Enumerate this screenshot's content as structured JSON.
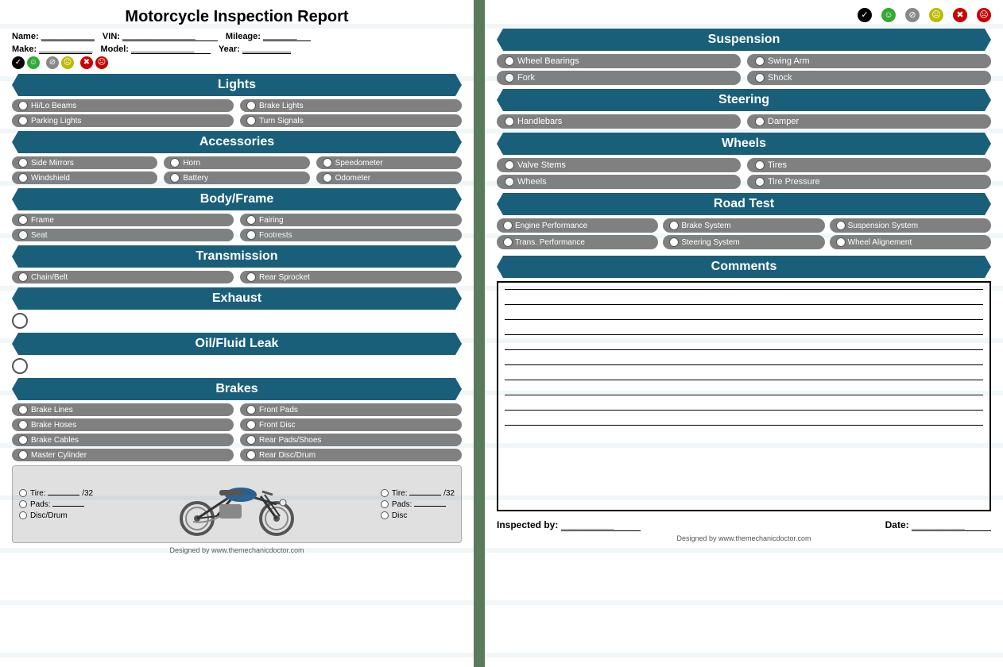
{
  "left": {
    "title": "Motorcycle Inspection Report",
    "fields": {
      "name_label": "Name:",
      "name_value": "___________",
      "vin_label": "VIN:",
      "vin_value": "_______________",
      "mileage_label": "Mileage:",
      "mileage_value": "_______",
      "make_label": "Make:",
      "make_value": "___________",
      "model_label": "Model:",
      "model_value": "_____________",
      "year_label": "Year:",
      "year_value": "__________"
    },
    "sections": {
      "lights": {
        "header": "Lights",
        "items": [
          "Hi/Lo Beams",
          "Parking Lights",
          "Brake Lights",
          "Turn Signals"
        ]
      },
      "accessories": {
        "header": "Accessories",
        "items": [
          "Side Mirrors",
          "Horn",
          "Speedometer",
          "Windshield",
          "Battery",
          "Odometer"
        ]
      },
      "body_frame": {
        "header": "Body/Frame",
        "items": [
          "Frame",
          "Fairing",
          "Seat",
          "Footrests"
        ]
      },
      "transmission": {
        "header": "Transmission",
        "items": [
          "Chain/Belt",
          "Rear Sprocket"
        ]
      },
      "exhaust": {
        "header": "Exhaust"
      },
      "oil_fluid": {
        "header": "Oil/Fluid Leak"
      },
      "brakes": {
        "header": "Brakes",
        "items": [
          "Brake Lines",
          "Front Pads",
          "Brake Hoses",
          "Front Disc",
          "Brake Cables",
          "Rear Pads/Shoes",
          "Master Cylinder",
          "Rear Disc/Drum"
        ]
      }
    },
    "tire_section": {
      "left_tire_label": "Tire:",
      "left_tire_value": "_______",
      "left_tire_unit": "/32",
      "left_pads_label": "Pads:",
      "left_pads_value": "_______",
      "left_disc_label": "Disc/Drum",
      "right_tire_label": "Tire:",
      "right_tire_value": "_______",
      "right_tire_unit": "/32",
      "right_pads_label": "Pads:",
      "right_pads_value": "_______",
      "right_disc_label": "Disc"
    },
    "footer": "Designed by www.themechanicdoctor.com"
  },
  "right": {
    "legend": [
      {
        "symbol": "✓",
        "class": "icon-good"
      },
      {
        "symbol": "☺",
        "class": "face-green"
      },
      {
        "symbol": "⊘",
        "class": "icon-ok"
      },
      {
        "symbol": "☹",
        "class": "face-yellow"
      },
      {
        "symbol": "✖",
        "class": "icon-bad"
      },
      {
        "symbol": "☹",
        "class": "face-red"
      }
    ],
    "sections": {
      "suspension": {
        "header": "Suspension",
        "items": [
          "Wheel Bearings",
          "Swing Arm",
          "Fork",
          "Shock"
        ]
      },
      "steering": {
        "header": "Steering",
        "items": [
          "Handlebars",
          "Damper"
        ]
      },
      "wheels": {
        "header": "Wheels",
        "items": [
          "Valve Stems",
          "Tires",
          "Wheels",
          "Tire Pressure"
        ]
      },
      "road_test": {
        "header": "Road Test",
        "items": [
          "Engine Performance",
          "Brake System",
          "Suspension System",
          "Trans. Performance",
          "Steering System",
          "Wheel Alignement"
        ]
      },
      "comments": {
        "header": "Comments"
      }
    },
    "signature": {
      "inspected_by_label": "Inspected by:",
      "inspected_by_value": "__________",
      "date_label": "Date:",
      "date_value": "__________"
    },
    "footer": "Designed by www.themechanicdoctor.com"
  }
}
